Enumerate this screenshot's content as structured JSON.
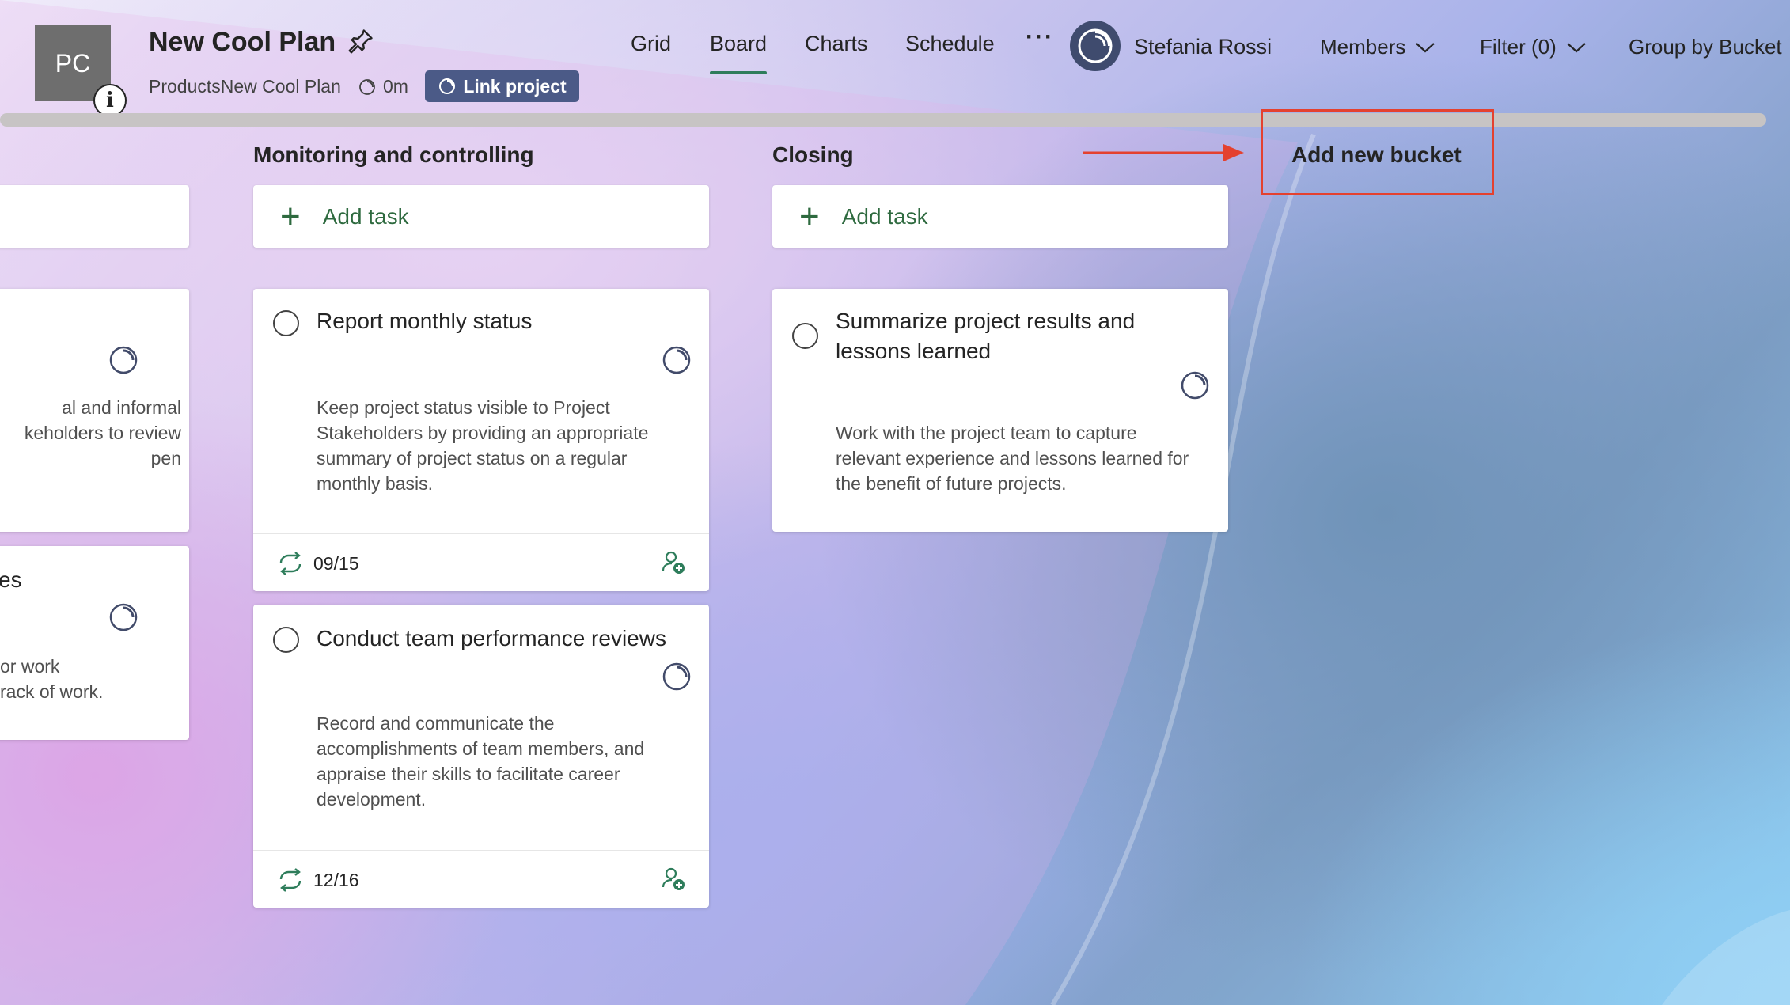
{
  "header": {
    "tile_initials": "PC",
    "info_glyph": "i",
    "plan_title": "New Cool Plan",
    "breadcrumb": "ProductsNew Cool Plan",
    "duration": "0m",
    "link_project_label": "Link project",
    "nav": [
      "Grid",
      "Board",
      "Charts",
      "Schedule"
    ],
    "active_tab": "Board",
    "more_label": "···",
    "user_name": "Stefania Rossi",
    "members_label": "Members",
    "filter_label": "Filter (0)",
    "group_by_label": "Group by Bucket"
  },
  "columns": [
    {
      "title": "",
      "add_task_label": "",
      "cards": [
        {
          "title": "",
          "description": "al and informal\nkeholders to review\npen"
        },
        {
          "title": "es",
          "description": "or work\nrack of work."
        }
      ]
    },
    {
      "title": "Monitoring and controlling",
      "add_task_label": "Add task",
      "cards": [
        {
          "title": "Report monthly status",
          "description": "Keep project status visible to Project Stakeholders by providing an appropriate summary of project status on a regular monthly basis.",
          "due": "09/15"
        },
        {
          "title": "Conduct team performance reviews",
          "description": "Record and communicate the accomplishments of team members, and appraise their skills to facilitate career development.",
          "due": "12/16"
        }
      ]
    },
    {
      "title": "Closing",
      "add_task_label": "Add task",
      "cards": [
        {
          "title": "Summarize project results and lessons learned",
          "description": "Work with the project team to capture relevant experience and lessons learned for the benefit of future projects."
        }
      ]
    }
  ],
  "add_bucket_label": "Add new bucket",
  "colors": {
    "accent_green": "#2e7d5b",
    "link_button": "#4b5a87",
    "highlight_red": "#e4412f"
  },
  "icons": [
    "pin-icon",
    "info-icon",
    "timer-icon",
    "avatar-icon",
    "chevron-down-icon",
    "plus-icon",
    "progress-icon",
    "repeat-icon",
    "assign-user-icon",
    "arrow-icon"
  ]
}
